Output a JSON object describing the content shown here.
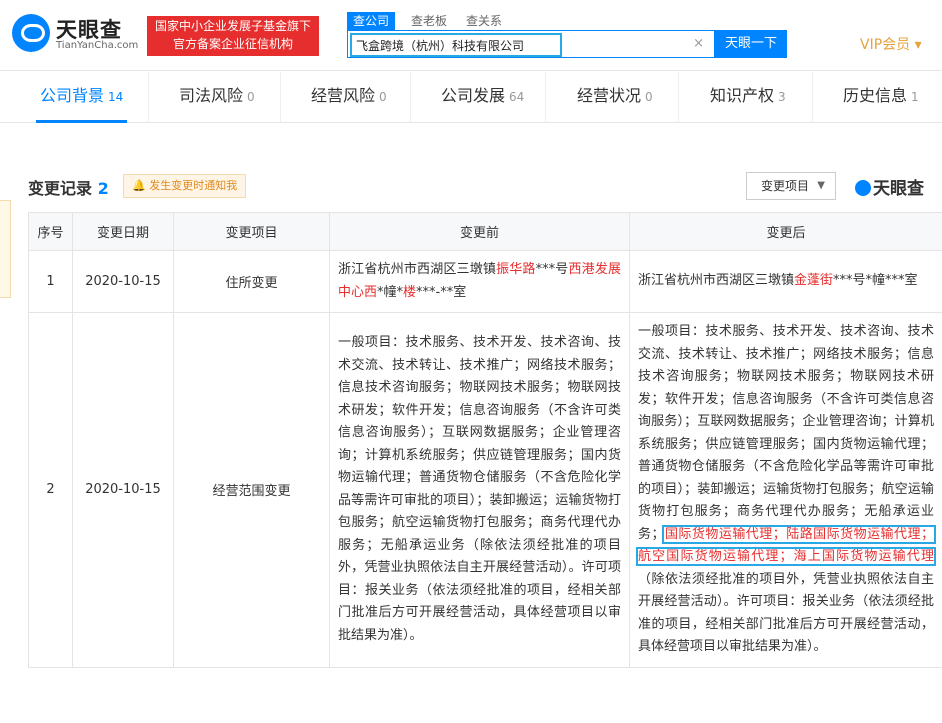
{
  "header": {
    "logo_cn": "天眼查",
    "logo_en": "TianYanCha.com",
    "badge_line1": "国家中小企业发展子基金旗下",
    "badge_line2": "官方备案企业征信机构",
    "search_tabs": [
      "查公司",
      "查老板",
      "查关系"
    ],
    "search_value": "飞盒跨境（杭州）科技有限公司",
    "search_button": "天眼一下",
    "vip_label": "VIP会员 ▾"
  },
  "tabs": [
    {
      "label": "公司背景",
      "count": "14"
    },
    {
      "label": "司法风险",
      "count": "0"
    },
    {
      "label": "经营风险",
      "count": "0"
    },
    {
      "label": "公司发展",
      "count": "64"
    },
    {
      "label": "经营状况",
      "count": "0"
    },
    {
      "label": "知识产权",
      "count": "3"
    },
    {
      "label": "历史信息",
      "count": "1"
    }
  ],
  "section": {
    "title": "变更记录",
    "count": "2",
    "notify_label": "发生变更时通知我",
    "filter_label": "变更项目",
    "watermark": "天眼查"
  },
  "table": {
    "headers": [
      "序号",
      "变更日期",
      "变更项目",
      "变更前",
      "变更后"
    ],
    "rows": [
      {
        "no": "1",
        "date": "2020-10-15",
        "item": "住所变更",
        "before": {
          "p1": "浙江省杭州市西湖区三墩镇",
          "r1": "振华路",
          "p2": "***号",
          "r2": "西港发展中心西",
          "p3": "*幢*",
          "r3": "楼",
          "p4": "***-**室"
        },
        "after": {
          "p1": "浙江省杭州市西湖区三墩镇",
          "r1": "金蓬街",
          "p2": "***号*幢***室"
        }
      },
      {
        "no": "2",
        "date": "2020-10-15",
        "item": "经营范围变更",
        "before": "一般项目：技术服务、技术开发、技术咨询、技术交流、技术转让、技术推广；网络技术服务；信息技术咨询服务；物联网技术服务；物联网技术研发；软件开发；信息咨询服务（不含许可类信息咨询服务）；互联网数据服务；企业管理咨询；计算机系统服务；供应链管理服务；国内货物运输代理；普通货物仓储服务（不含危险化学品等需许可审批的项目）；装卸搬运；运输货物打包服务；航空运输货物打包服务；商务代理代办服务；无船承运业务（除依法须经批准的项目外，凭营业执照依法自主开展经营活动）。许可项目：报关业务（依法须经批准的项目，经相关部门批准后方可开展经营活动，具体经营项目以审批结果为准）。",
        "after": {
          "p1": "一般项目：技术服务、技术开发、技术咨询、技术交流、技术转让、技术推广；网络技术服务；信息技术咨询服务；物联网技术服务；物联网技术研发；软件开发；信息咨询服务（不含许可类信息咨询服务）；互联网数据服务；企业管理咨询；计算机系统服务；供应链管理服务；国内货物运输代理；普通货物仓储服务（不含危险化学品等需许可审批的项目）；装卸搬运；运输货物打包服务；航空运输货物打包服务；商务代理代办服务；无船承运业务；",
          "r1": "国际货物运输代理；陆路国际货物运输代理；航空国际货物运输代理；海上国际货物运输代理",
          "p2": "（除依法须经批准的项目外，凭营业执照依法自主开展经营活动）。许可项目：报关业务（依法须经批准的项目，经相关部门批准后方可开展经营活动，具体经营项目以审批结果为准）。"
        }
      }
    ]
  }
}
